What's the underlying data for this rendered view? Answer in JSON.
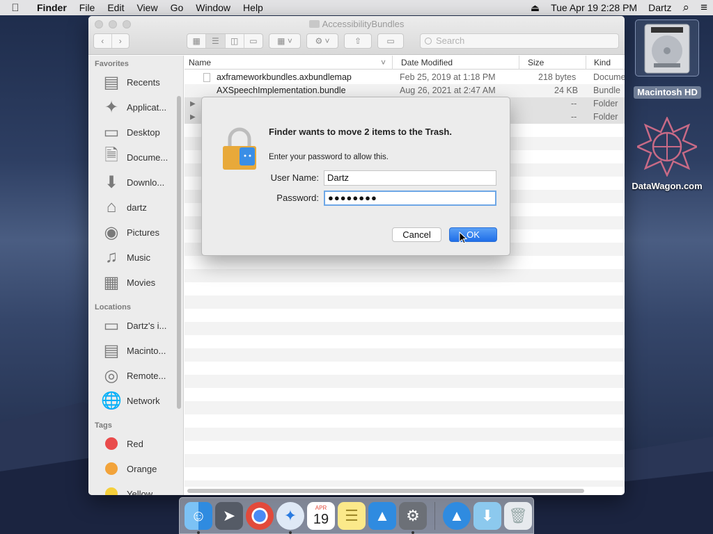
{
  "menubar": {
    "apple": "",
    "items": [
      "Finder",
      "File",
      "Edit",
      "View",
      "Go",
      "Window",
      "Help"
    ],
    "eject": "⏏",
    "datetime": "Tue Apr 19  2:28 PM",
    "user": "Dartz",
    "search_icon": "⌕",
    "list_icon": "≡"
  },
  "window": {
    "title": "AccessibilityBundles",
    "search_placeholder": "Search"
  },
  "sidebar": {
    "favorites_header": "Favorites",
    "favorites": [
      {
        "label": "Recents",
        "icon": "recents-icon"
      },
      {
        "label": "Applicat...",
        "icon": "applications-icon"
      },
      {
        "label": "Desktop",
        "icon": "desktop-icon"
      },
      {
        "label": "Docume...",
        "icon": "documents-icon"
      },
      {
        "label": "Downlo...",
        "icon": "downloads-icon"
      },
      {
        "label": "dartz",
        "icon": "home-icon"
      },
      {
        "label": "Pictures",
        "icon": "pictures-icon"
      },
      {
        "label": "Music",
        "icon": "music-icon"
      },
      {
        "label": "Movies",
        "icon": "movies-icon"
      }
    ],
    "locations_header": "Locations",
    "locations": [
      {
        "label": "Dartz's i...",
        "icon": "computer-icon"
      },
      {
        "label": "Macinto...",
        "icon": "disk-icon"
      },
      {
        "label": "Remote...",
        "icon": "remote-disc-icon"
      },
      {
        "label": "Network",
        "icon": "network-icon"
      }
    ],
    "tags_header": "Tags",
    "tags": [
      {
        "label": "Red",
        "color": "#e94b4b"
      },
      {
        "label": "Orange",
        "color": "#f2a33a"
      },
      {
        "label": "Yellow",
        "color": "#f5cf3b"
      }
    ]
  },
  "columns": {
    "name": "Name",
    "date": "Date Modified",
    "size": "Size",
    "kind": "Kind"
  },
  "files": [
    {
      "name": "axframeworkbundles.axbundlemap",
      "date": "Feb 25, 2019 at 1:18 PM",
      "size": "218 bytes",
      "kind": "Docume"
    },
    {
      "name": "AXSpeechImplementation.bundle",
      "date": "Aug 26, 2021 at 2:47 AM",
      "size": "24 KB",
      "kind": "Bundle"
    },
    {
      "name": "",
      "date": "",
      "size": "--",
      "kind": "Folder"
    },
    {
      "name": "",
      "date": "",
      "size": "--",
      "kind": "Folder"
    }
  ],
  "dialog": {
    "title": "Finder wants to move 2 items to the Trash.",
    "message": "Enter your password to allow this.",
    "username_label": "User Name:",
    "username_value": "Dartz",
    "password_label": "Password:",
    "password_value": "●●●●●●●●",
    "cancel_label": "Cancel",
    "ok_label": "OK"
  },
  "desktop": {
    "hd_label": "Macintosh HD",
    "dw_label": "DataWagon.com"
  },
  "dock": {
    "calendar_month": "APR",
    "calendar_day": "19"
  }
}
